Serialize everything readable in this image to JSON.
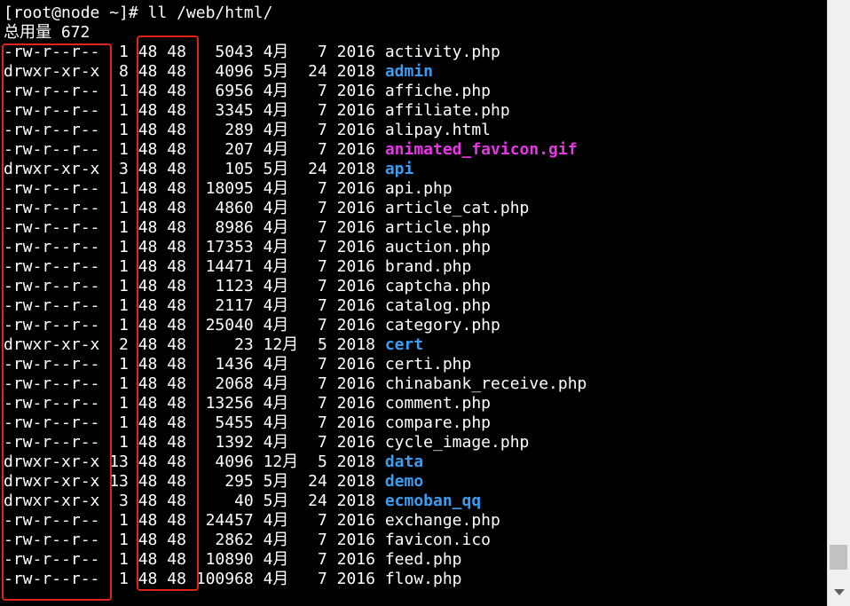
{
  "terminal": {
    "prompt_line": "[root@node ~]# ll /web/html/",
    "total_line": "总用量 672",
    "entries": [
      {
        "meta": "-rw-r--r--  1 48 48   5043 4月   7 2016 ",
        "name": "activity.php",
        "kind": "file"
      },
      {
        "meta": "drwxr-xr-x  8 48 48   4096 5月  24 2018 ",
        "name": "admin",
        "kind": "dir"
      },
      {
        "meta": "-rw-r--r--  1 48 48   6956 4月   7 2016 ",
        "name": "affiche.php",
        "kind": "file"
      },
      {
        "meta": "-rw-r--r--  1 48 48   3345 4月   7 2016 ",
        "name": "affiliate.php",
        "kind": "file"
      },
      {
        "meta": "-rw-r--r--  1 48 48    289 4月   7 2016 ",
        "name": "alipay.html",
        "kind": "file"
      },
      {
        "meta": "-rw-r--r--  1 48 48    207 4月   7 2016 ",
        "name": "animated_favicon.gif",
        "kind": "img"
      },
      {
        "meta": "drwxr-xr-x  3 48 48    105 5月  24 2018 ",
        "name": "api",
        "kind": "dir"
      },
      {
        "meta": "-rw-r--r--  1 48 48  18095 4月   7 2016 ",
        "name": "api.php",
        "kind": "file"
      },
      {
        "meta": "-rw-r--r--  1 48 48   4860 4月   7 2016 ",
        "name": "article_cat.php",
        "kind": "file"
      },
      {
        "meta": "-rw-r--r--  1 48 48   8986 4月   7 2016 ",
        "name": "article.php",
        "kind": "file"
      },
      {
        "meta": "-rw-r--r--  1 48 48  17353 4月   7 2016 ",
        "name": "auction.php",
        "kind": "file"
      },
      {
        "meta": "-rw-r--r--  1 48 48  14471 4月   7 2016 ",
        "name": "brand.php",
        "kind": "file"
      },
      {
        "meta": "-rw-r--r--  1 48 48   1123 4月   7 2016 ",
        "name": "captcha.php",
        "kind": "file"
      },
      {
        "meta": "-rw-r--r--  1 48 48   2117 4月   7 2016 ",
        "name": "catalog.php",
        "kind": "file"
      },
      {
        "meta": "-rw-r--r--  1 48 48  25040 4月   7 2016 ",
        "name": "category.php",
        "kind": "file"
      },
      {
        "meta": "drwxr-xr-x  2 48 48     23 12月  5 2018 ",
        "name": "cert",
        "kind": "dir"
      },
      {
        "meta": "-rw-r--r--  1 48 48   1436 4月   7 2016 ",
        "name": "certi.php",
        "kind": "file"
      },
      {
        "meta": "-rw-r--r--  1 48 48   2068 4月   7 2016 ",
        "name": "chinabank_receive.php",
        "kind": "file"
      },
      {
        "meta": "-rw-r--r--  1 48 48  13256 4月   7 2016 ",
        "name": "comment.php",
        "kind": "file"
      },
      {
        "meta": "-rw-r--r--  1 48 48   5455 4月   7 2016 ",
        "name": "compare.php",
        "kind": "file"
      },
      {
        "meta": "-rw-r--r--  1 48 48   1392 4月   7 2016 ",
        "name": "cycle_image.php",
        "kind": "file"
      },
      {
        "meta": "drwxr-xr-x 13 48 48   4096 12月  5 2018 ",
        "name": "data",
        "kind": "dir"
      },
      {
        "meta": "drwxr-xr-x 13 48 48    295 5月  24 2018 ",
        "name": "demo",
        "kind": "dir"
      },
      {
        "meta": "drwxr-xr-x  3 48 48     40 5月  24 2018 ",
        "name": "ecmoban_qq",
        "kind": "dir"
      },
      {
        "meta": "-rw-r--r--  1 48 48  24457 4月   7 2016 ",
        "name": "exchange.php",
        "kind": "file"
      },
      {
        "meta": "-rw-r--r--  1 48 48   2862 4月   7 2016 ",
        "name": "favicon.ico",
        "kind": "file"
      },
      {
        "meta": "-rw-r--r--  1 48 48  10890 4月   7 2016 ",
        "name": "feed.php",
        "kind": "file"
      },
      {
        "meta": "-rw-r--r--  1 48 48 100968 4月   7 2016 ",
        "name": "flow.php",
        "kind": "file"
      }
    ]
  },
  "colors": {
    "background": "#000000",
    "text": "#ffffff",
    "directory": "#3b9df2",
    "image": "#e835e8",
    "highlight": "#e0241a"
  }
}
